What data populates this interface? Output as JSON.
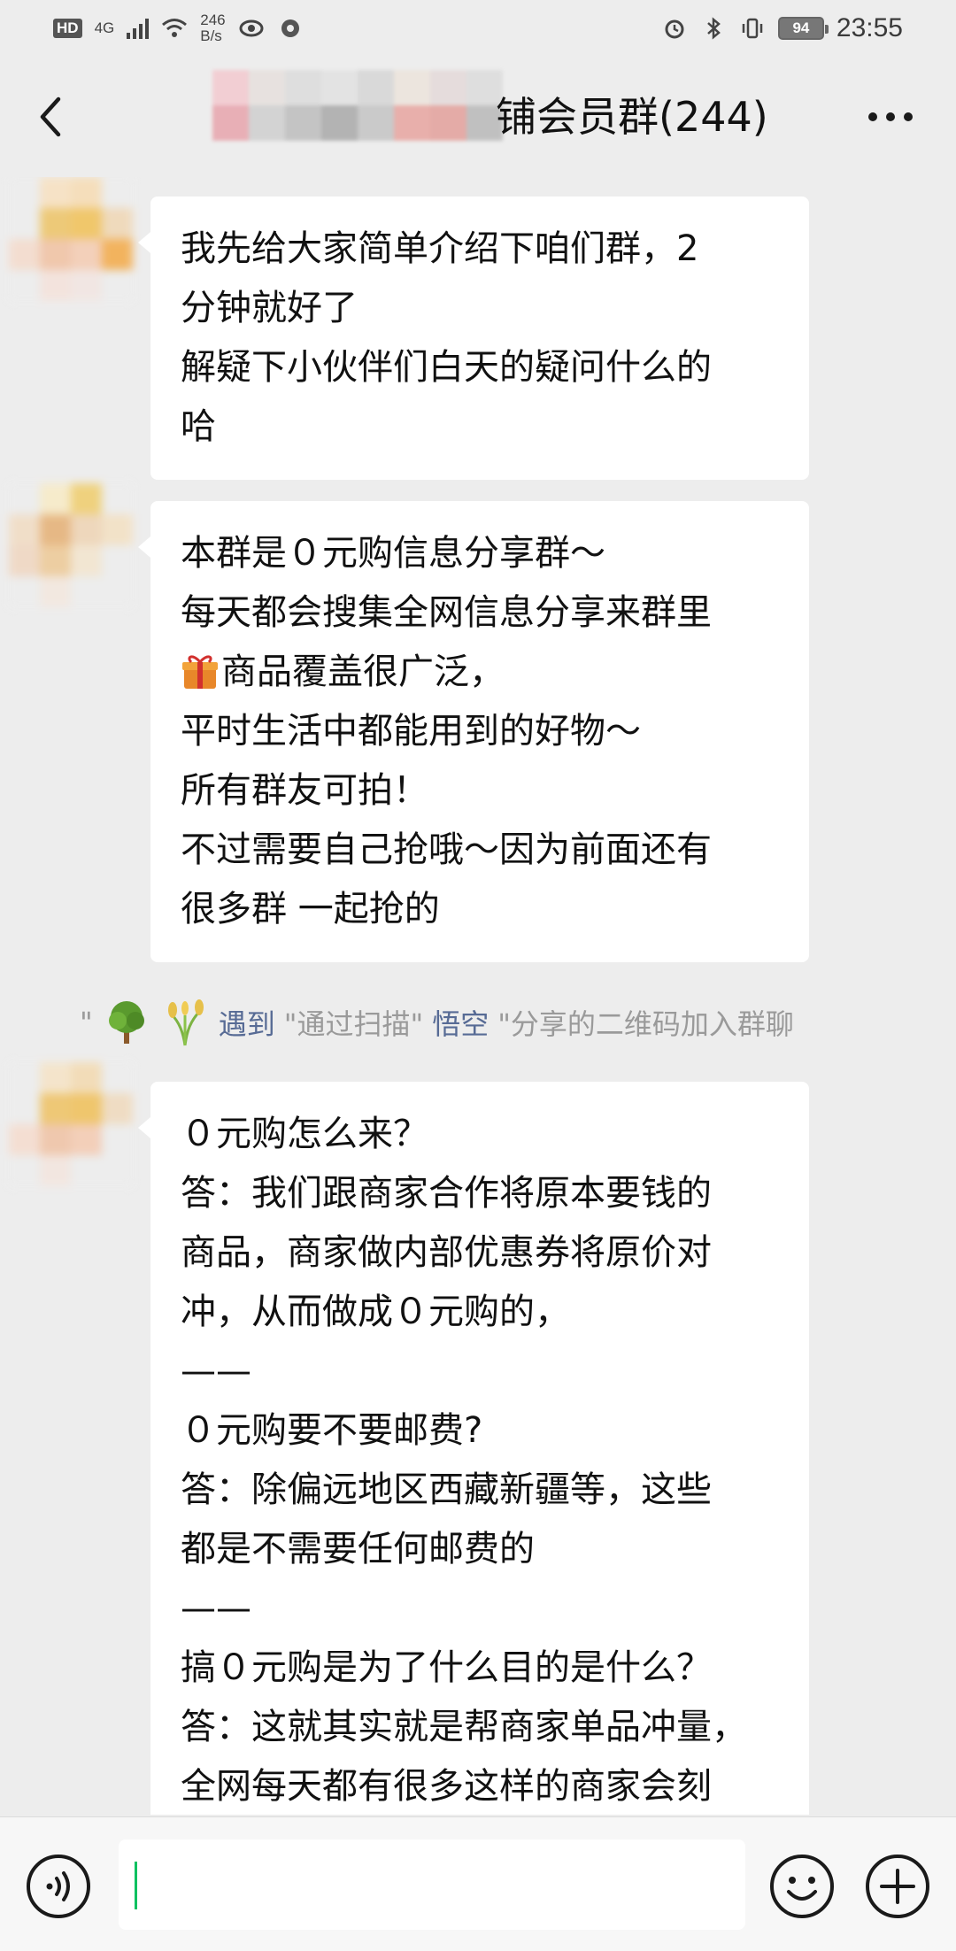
{
  "status_bar": {
    "hd": "HD",
    "network": "4G",
    "speed_value": "246",
    "speed_unit": "B/s",
    "battery": "94",
    "time": "23:55"
  },
  "header": {
    "title": "铺会员群(244)"
  },
  "messages": [
    {
      "lines": [
        "我先给大家简单介绍下咱们群，2",
        "分钟就好了",
        "解疑下小伙伴们白天的疑问什么的",
        "哈"
      ]
    },
    {
      "lines": [
        "本群是０元购信息分享群～",
        "每天都会搜集全网信息分享来群里",
        "商品覆盖很广泛，",
        "平时生活中都能用到的好物～",
        "所有群友可拍！",
        "不过需要自己抢哦～因为前面还有",
        "很多群 一起抢的"
      ]
    },
    {
      "lines": [
        "０元购怎么来？",
        "答：我们跟商家合作将原本要钱的",
        "商品，商家做内部优惠券将原价对",
        "冲，从而做成０元购的，",
        "——",
        "０元购要不要邮费?",
        "答：除偏远地区西藏新疆等，这些",
        "都是不需要任何邮费的",
        "——",
        "搞０元购是为了什么目的是什么？",
        "答：这就其实就是帮商家单品冲量，",
        "全网每天都有很多这样的商家会刻"
      ]
    }
  ],
  "system_notice": {
    "quote_open": "\"",
    "name": "遇到",
    "mid1": "\"通过扫描\"",
    "inviter": "悟空",
    "tail": "\"分享的二维码加入群聊"
  },
  "input_bar": {
    "value": ""
  },
  "icons": {
    "back": "chevron-left-icon",
    "more": "more-dots-icon",
    "voice": "voice-icon",
    "emoji": "emoji-icon",
    "plus": "plus-icon",
    "gift": "gift-icon"
  },
  "colors": {
    "background": "#ededed",
    "bubble": "#ffffff",
    "link": "#576b95",
    "caret": "#07c160"
  }
}
